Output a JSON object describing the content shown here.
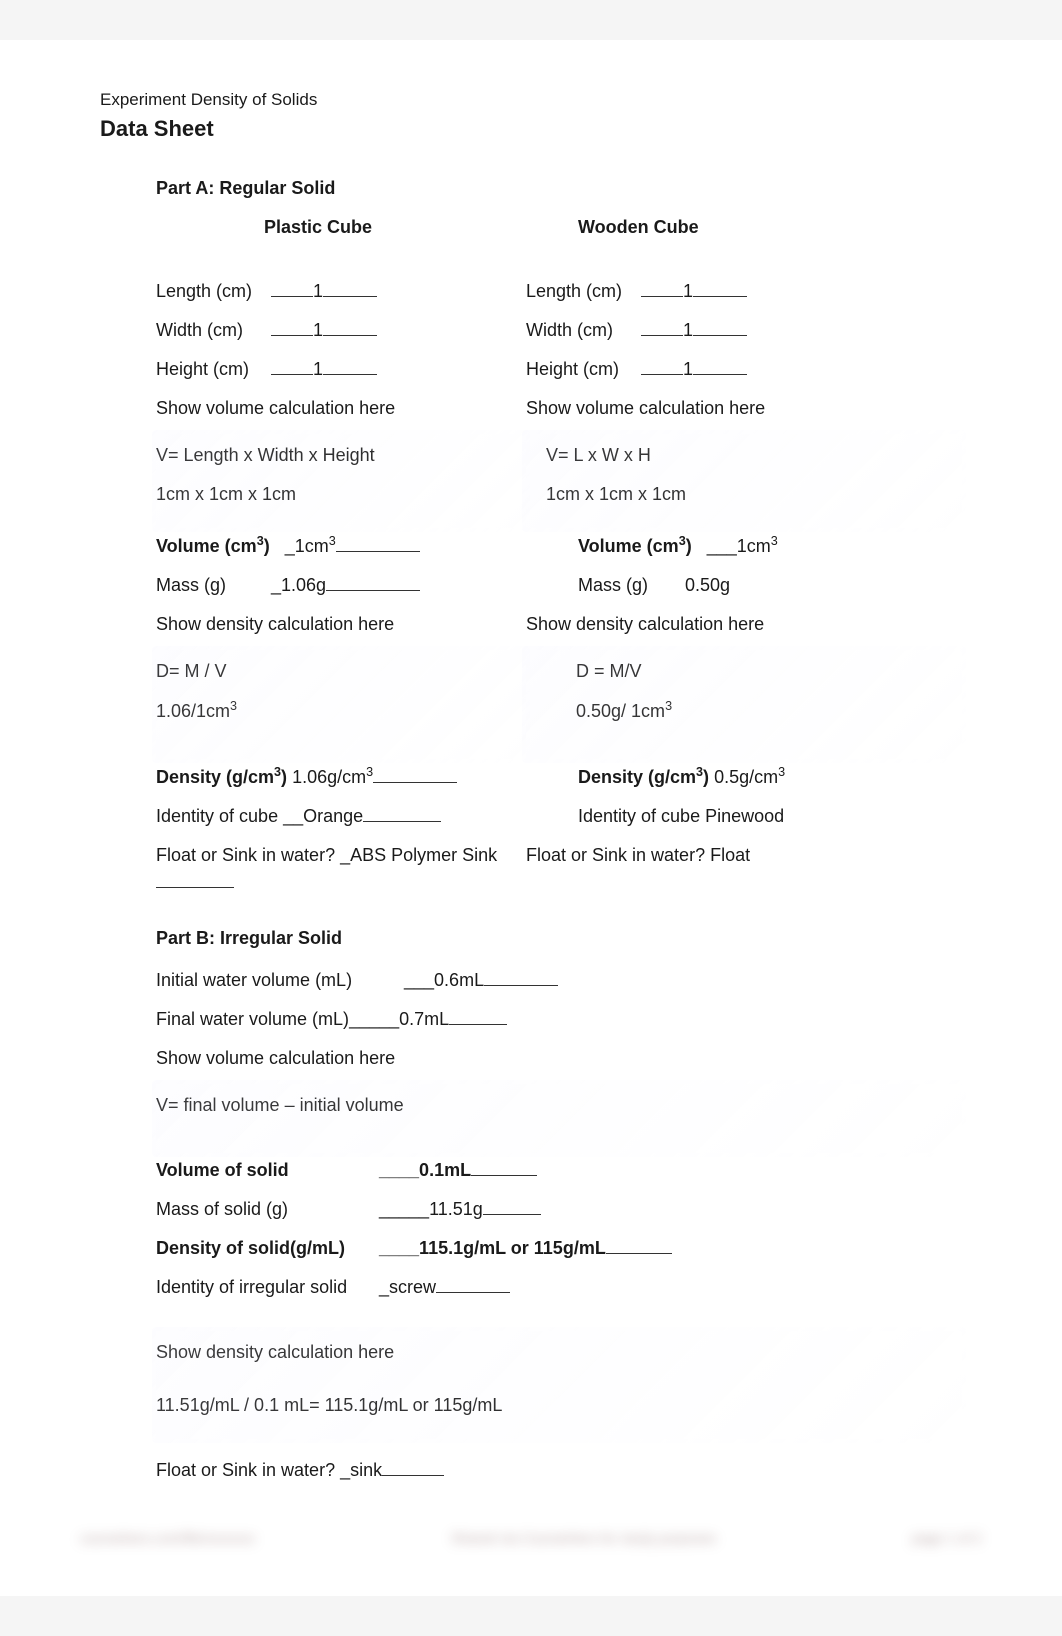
{
  "header": {
    "topline": "Experiment Density of Solids",
    "title": "Data Sheet"
  },
  "partA": {
    "title": "Part A: Regular Solid",
    "plastic": {
      "heading": "Plastic Cube",
      "length_label": "Length (cm)",
      "length_val": "1",
      "width_label": "Width (cm)",
      "width_val": "1",
      "height_label": "Height (cm)",
      "height_val": "1",
      "show_vol": "Show volume calculation here",
      "vol_formula": "V= Length x Width x Height",
      "vol_calc": "1cm x 1cm x 1cm",
      "volume_label": "Volume (cm",
      "volume_label_sup": "3",
      "volume_label_close": ")",
      "volume_val_pre": "_",
      "volume_val": "1cm",
      "volume_val_sup": "3",
      "mass_label": "Mass (g)",
      "mass_val": "_1.06g",
      "show_dens": "Show density calculation here",
      "dens_formula": "D= M / V",
      "dens_calc": "1.06/1cm",
      "dens_calc_sup": "3",
      "density_label": "Density (g/cm",
      "density_label_sup": "3",
      "density_label_close": ")",
      "density_val": "1.06g/cm",
      "density_val_sup": "3",
      "identity_label": "Identity of cube",
      "identity_val": "__Orange",
      "float_label": "Float or Sink in water?",
      "float_val": "_ABS Polymer Sink"
    },
    "wooden": {
      "heading": "Wooden Cube",
      "length_label": "Length (cm)",
      "length_val": "1",
      "width_label": "Width (cm)",
      "width_val": "1",
      "height_label": "Height (cm)",
      "height_val": "1",
      "show_vol": "Show volume calculation here",
      "vol_formula": "V= L x W x H",
      "vol_calc": "1cm x 1cm x 1cm",
      "volume_label": "Volume (cm",
      "volume_label_sup": "3",
      "volume_label_close": ")",
      "volume_val_pre": "___",
      "volume_val": "1cm",
      "volume_val_sup": "3",
      "mass_label": "Mass (g)",
      "mass_val": "0.50g",
      "show_dens": "Show density calculation here",
      "dens_formula": "D = M/V",
      "dens_calc": "0.50g/ 1cm",
      "dens_calc_sup": "3",
      "density_label": "Density (g/cm",
      "density_label_sup": "3",
      "density_label_close": ")",
      "density_val": "0.5g/cm",
      "density_val_sup": "3",
      "identity_label": "Identity of cube",
      "identity_val": "Pinewood",
      "float_label": "Float or Sink in water?",
      "float_val": "Float"
    }
  },
  "partB": {
    "title": "Part B:  Irregular Solid",
    "initial_label": "Initial water volume (mL)",
    "initial_val": "___0.6mL",
    "final_label": "Final water volume (mL)",
    "final_val": "_____0.7mL",
    "show_vol": "Show volume calculation here",
    "vol_formula": "V= final volume – initial volume",
    "volume_label": "Volume of solid",
    "volume_val": "____0.1mL",
    "mass_label": "Mass of solid (g)",
    "mass_val": "_____11.51g",
    "density_label": "Density of solid(g/mL)",
    "density_val": "____115.1g/mL or 115g/mL",
    "identity_label": "Identity of irregular solid",
    "identity_val": "_screw",
    "show_dens": "Show density calculation here",
    "dens_calc": "11.51g/mL / 0.1 mL= 115.1g/mL or 115g/mL",
    "float_label": "Float or Sink in water?",
    "float_val": "_sink"
  },
  "footer": {
    "left": "coursehero.com/file/xxxxxxx",
    "center": "Shared via CourseHero for study purposes",
    "right": "page 1 of 2"
  }
}
